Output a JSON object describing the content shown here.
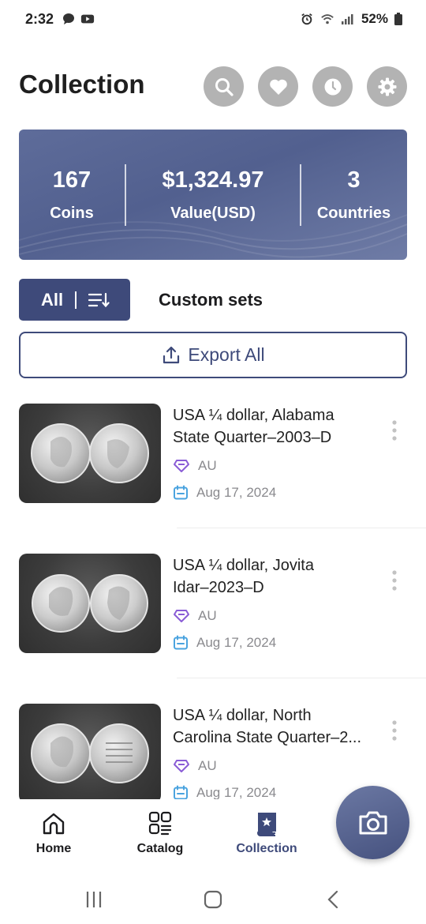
{
  "status_bar": {
    "time": "2:32",
    "battery": "52%"
  },
  "header": {
    "title": "Collection"
  },
  "summary": {
    "coins_count": "167",
    "coins_label": "Coins",
    "value": "$1,324.97",
    "value_label": "Value(USD)",
    "countries_count": "3",
    "countries_label": "Countries"
  },
  "filters": {
    "all_label": "All",
    "custom_label": "Custom sets"
  },
  "export": {
    "label": "Export All"
  },
  "coins": [
    {
      "title_line1": "USA ¼ dollar, Alabama",
      "title_line2": "State Quarter–2003–D",
      "grade": "AU",
      "date": "Aug 17, 2024"
    },
    {
      "title_line1": "USA ¼ dollar, Jovita",
      "title_line2": "Idar–2023–D",
      "grade": "AU",
      "date": "Aug 17, 2024"
    },
    {
      "title_line1": "USA ¼ dollar, North",
      "title_line2": "Carolina State Quarter–2...",
      "grade": "AU",
      "date": "Aug 17, 2024"
    }
  ],
  "bottom_nav": {
    "home": "Home",
    "catalog": "Catalog",
    "collection": "Collection"
  },
  "colors": {
    "primary": "#3e4a7a",
    "card_bg": "#5e6c9a",
    "grade_icon": "#8a5cd6",
    "date_icon": "#4aa3df"
  },
  "icons": [
    "search-icon",
    "heart-icon",
    "clock-icon",
    "gear-icon",
    "sort-icon",
    "upload-icon",
    "diamond-icon",
    "calendar-icon",
    "more-vertical-icon",
    "home-icon",
    "catalog-icon",
    "collection-icon",
    "camera-icon"
  ]
}
